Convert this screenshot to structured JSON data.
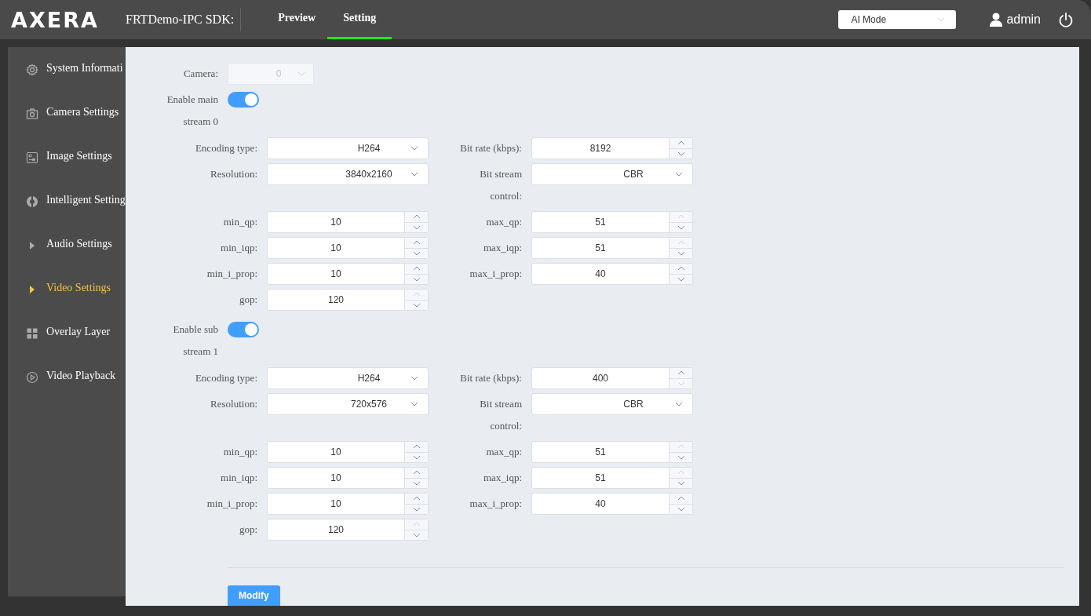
{
  "header": {
    "logo": "AXERA",
    "title": "FRTDemo-IPC SDK:",
    "tabs": [
      {
        "label": "Preview",
        "selected": false
      },
      {
        "label": "Setting",
        "selected": true
      }
    ],
    "mode_select": {
      "value": "AI Mode"
    },
    "user": "admin"
  },
  "sidebar": {
    "items": [
      {
        "label": "System Informati",
        "kind": "gear",
        "selected": false
      },
      {
        "label": "Camera Settings",
        "kind": "camera",
        "selected": false
      },
      {
        "label": "Image Settings",
        "kind": "image",
        "selected": false
      },
      {
        "label": "Intelligent Setting",
        "kind": "target",
        "selected": false
      },
      {
        "label": "Audio Settings",
        "kind": "expandable",
        "selected": false
      },
      {
        "label": "Video Settings",
        "kind": "expandable",
        "selected": true
      },
      {
        "label": "Overlay Layer",
        "kind": "grid",
        "selected": false
      },
      {
        "label": "Video Playback",
        "kind": "play",
        "selected": false
      }
    ]
  },
  "camera": {
    "label": "Camera:",
    "value": "0",
    "disabled": true
  },
  "streams": [
    {
      "label": "Enable main stream 0",
      "on": true,
      "rows": [
        [
          {
            "label": "Encoding type:",
            "kind": "select",
            "value": "H264"
          },
          {
            "label": "Bit rate (kbps):",
            "kind": "number",
            "value": "8192",
            "up_disabled": false,
            "down_disabled": false
          }
        ],
        [
          {
            "label": "Resolution:",
            "kind": "select",
            "value": "3840x2160"
          },
          {
            "label": "Bit stream control:",
            "kind": "select",
            "value": "CBR"
          }
        ],
        [
          {
            "label": "min_qp:",
            "kind": "number",
            "value": "10",
            "up_disabled": false,
            "down_disabled": false
          },
          {
            "label": "max_qp:",
            "kind": "number",
            "value": "51",
            "up_disabled": true,
            "down_disabled": false
          }
        ],
        [
          {
            "label": "min_iqp:",
            "kind": "number",
            "value": "10",
            "up_disabled": false,
            "down_disabled": false
          },
          {
            "label": "max_iqp:",
            "kind": "number",
            "value": "51",
            "up_disabled": true,
            "down_disabled": false
          }
        ],
        [
          {
            "label": "min_i_prop:",
            "kind": "number",
            "value": "10",
            "up_disabled": false,
            "down_disabled": false
          },
          {
            "label": "max_i_prop:",
            "kind": "number",
            "value": "40",
            "up_disabled": false,
            "down_disabled": false
          }
        ],
        [
          {
            "label": "gop:",
            "kind": "number",
            "value": "120",
            "up_disabled": true,
            "down_disabled": false
          }
        ]
      ]
    },
    {
      "label": "Enable sub stream 1",
      "on": true,
      "rows": [
        [
          {
            "label": "Encoding type:",
            "kind": "select",
            "value": "H264"
          },
          {
            "label": "Bit rate (kbps):",
            "kind": "number",
            "value": "400",
            "up_disabled": false,
            "down_disabled": true
          }
        ],
        [
          {
            "label": "Resolution:",
            "kind": "select",
            "value": "720x576"
          },
          {
            "label": "Bit stream control:",
            "kind": "select",
            "value": "CBR"
          }
        ],
        [
          {
            "label": "min_qp:",
            "kind": "number",
            "value": "10",
            "up_disabled": false,
            "down_disabled": false
          },
          {
            "label": "max_qp:",
            "kind": "number",
            "value": "51",
            "up_disabled": true,
            "down_disabled": false
          }
        ],
        [
          {
            "label": "min_iqp:",
            "kind": "number",
            "value": "10",
            "up_disabled": false,
            "down_disabled": false
          },
          {
            "label": "max_iqp:",
            "kind": "number",
            "value": "51",
            "up_disabled": true,
            "down_disabled": false
          }
        ],
        [
          {
            "label": "min_i_prop:",
            "kind": "number",
            "value": "10",
            "up_disabled": false,
            "down_disabled": false
          },
          {
            "label": "max_i_prop:",
            "kind": "number",
            "value": "40",
            "up_disabled": false,
            "down_disabled": false
          }
        ],
        [
          {
            "label": "gop:",
            "kind": "number",
            "value": "120",
            "up_disabled": true,
            "down_disabled": false
          }
        ]
      ]
    }
  ],
  "submit": "Modify"
}
